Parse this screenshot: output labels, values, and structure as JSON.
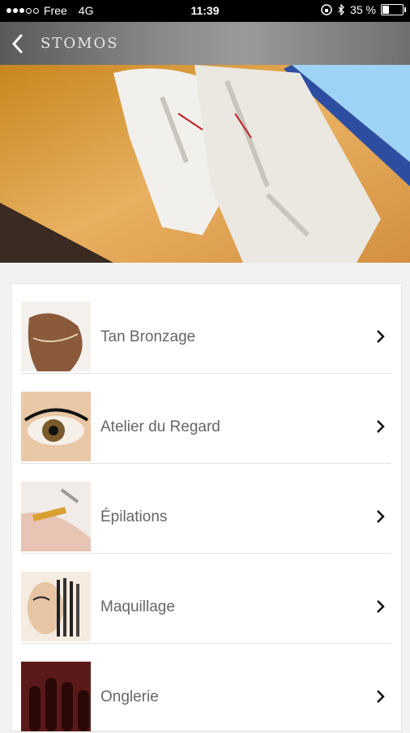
{
  "status_bar": {
    "carrier": "Free",
    "network": "4G",
    "time": "11:39",
    "battery_percent": "35 %",
    "battery_level": 0.35
  },
  "nav": {
    "title": "STOMOS"
  },
  "services": [
    {
      "label": "Tan Bronzage",
      "thumb": "tan-bronzage-thumbnail"
    },
    {
      "label": "Atelier du Regard",
      "thumb": "eye-lashes-thumbnail"
    },
    {
      "label": "Épilations",
      "thumb": "waxing-thumbnail"
    },
    {
      "label": "Maquillage",
      "thumb": "makeup-brushes-thumbnail"
    },
    {
      "label": "Onglerie",
      "thumb": "nails-thumbnail"
    }
  ],
  "colors": {
    "status_bg": "#000000",
    "label_text": "#666666",
    "hero_gold": "#d89a3a"
  }
}
